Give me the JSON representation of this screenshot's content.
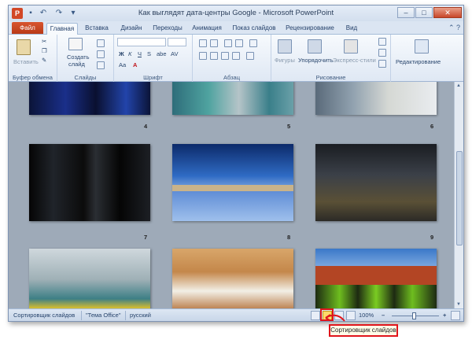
{
  "window": {
    "title": "Как выглядят дата-центры Google - Microsoft PowerPoint",
    "app_icon": "P",
    "controls": {
      "minimize": "–",
      "maximize": "□",
      "close": "✕"
    }
  },
  "quick_access": {
    "save_icon": "floppy-icon",
    "undo_icon": "undo-icon",
    "redo_icon": "redo-icon",
    "customize_icon": "chevron-down-icon"
  },
  "tabs": {
    "file": "Файл",
    "items": [
      "Главная",
      "Вставка",
      "Дизайн",
      "Переходы",
      "Анимация",
      "Показ слайдов",
      "Рецензирование",
      "Вид"
    ],
    "active": "Главная"
  },
  "ribbon": {
    "clipboard": {
      "label": "Буфер обмена",
      "paste": "Вставить"
    },
    "slides": {
      "label": "Слайды",
      "new_slide_line1": "Создать",
      "new_slide_line2": "слайд"
    },
    "font": {
      "label": "Шрифт",
      "bold": "Ж",
      "italic": "К",
      "underline": "Ч",
      "strike": "S",
      "shadow": "abe",
      "spacing": "AV",
      "case": "Aa",
      "color": "A"
    },
    "paragraph": {
      "label": "Абзац"
    },
    "drawing": {
      "label": "Рисование",
      "shapes": "Фигуры",
      "arrange": "Упорядочить",
      "quick_styles": "Экспресс-стили"
    },
    "editing": {
      "label": "Редактирование"
    }
  },
  "slides": [
    {
      "number": "4"
    },
    {
      "number": "5"
    },
    {
      "number": "6"
    },
    {
      "number": "7"
    },
    {
      "number": "8"
    },
    {
      "number": "9"
    },
    {
      "number": ""
    },
    {
      "number": ""
    },
    {
      "number": ""
    }
  ],
  "status": {
    "view_name": "Сортировщик слайдов",
    "theme": "\"Тема Office\"",
    "language": "русский",
    "zoom": "100%",
    "zoom_minus": "–",
    "zoom_plus": "+"
  },
  "callout": {
    "text": "Сортировщик слайдов"
  },
  "colors": {
    "highlight": "#e0151b",
    "file_tab": "#c64220"
  }
}
